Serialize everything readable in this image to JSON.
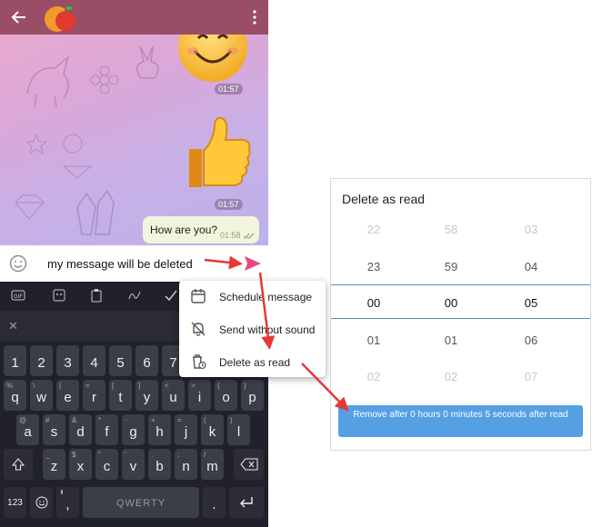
{
  "chat": {
    "times": [
      "01:57",
      "01:57",
      "01:58"
    ],
    "message": "How are you?",
    "colors": {
      "topbar": "#9a4e66",
      "bubble": "#f2f5dc",
      "accent": "#e54a87"
    }
  },
  "input": {
    "text": "my message will be deleted"
  },
  "keyboard": {
    "row_numbers": [
      "1",
      "2",
      "3",
      "4",
      "5",
      "6",
      "7",
      "8",
      "9",
      "0"
    ],
    "row1": [
      {
        "main": "q",
        "alt": "%"
      },
      {
        "main": "w",
        "alt": "\\"
      },
      {
        "main": "e",
        "alt": "|"
      },
      {
        "main": "r",
        "alt": "="
      },
      {
        "main": "t",
        "alt": "["
      },
      {
        "main": "y",
        "alt": "]"
      },
      {
        "main": "u",
        "alt": "<"
      },
      {
        "main": "i",
        "alt": ">"
      },
      {
        "main": "o",
        "alt": "{"
      },
      {
        "main": "p",
        "alt": "}"
      }
    ],
    "row2": [
      {
        "main": "a",
        "alt": "@"
      },
      {
        "main": "s",
        "alt": "#"
      },
      {
        "main": "d",
        "alt": "&"
      },
      {
        "main": "f",
        "alt": "*"
      },
      {
        "main": "g",
        "alt": "-"
      },
      {
        "main": "h",
        "alt": "+"
      },
      {
        "main": "j",
        "alt": "="
      },
      {
        "main": "k",
        "alt": "("
      },
      {
        "main": "l",
        "alt": ")"
      }
    ],
    "row3": [
      {
        "main": "z",
        "alt": "_"
      },
      {
        "main": "x",
        "alt": "$"
      },
      {
        "main": "c",
        "alt": "\""
      },
      {
        "main": "v",
        "alt": "'"
      },
      {
        "main": "b",
        "alt": ":"
      },
      {
        "main": "n",
        "alt": ";"
      },
      {
        "main": "m",
        "alt": "/"
      }
    ],
    "symbols_label": "123",
    "comma": ",",
    "space_label": "QWERTY",
    "period": "."
  },
  "popup": {
    "items": [
      {
        "label": "Schedule message",
        "icon": "calendar-icon"
      },
      {
        "label": "Send without sound",
        "icon": "bell-off-icon"
      },
      {
        "label": "Delete as read",
        "icon": "trash-clock-icon"
      }
    ]
  },
  "dialog": {
    "title": "Delete as read",
    "columns": [
      [
        "22",
        "23",
        "00",
        "01",
        "02"
      ],
      [
        "58",
        "59",
        "00",
        "01",
        "02"
      ],
      [
        "03",
        "04",
        "05",
        "06",
        "07"
      ]
    ],
    "button": "Remove after 0 hours 0 minutes 5 seconds after read",
    "colors": {
      "button": "#55a0e3",
      "divider": "#4f8fd0"
    }
  },
  "annotations": {
    "arrow_color": "#e53935"
  }
}
